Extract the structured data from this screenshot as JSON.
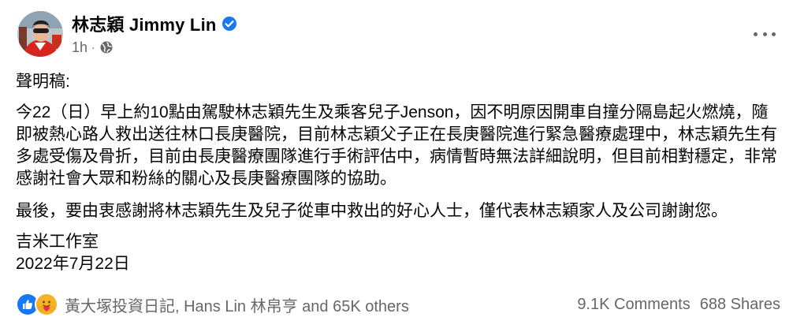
{
  "post": {
    "author": "林志穎 Jimmy Lin",
    "timestamp": "1h",
    "separator": "·",
    "body": {
      "greeting": "聲明稿:",
      "main": "今22（日）早上約10點由駕駛林志穎先生及乘客兒子Jenson，因不明原因開車自撞分隔島起火燃燒，隨即被熱心路人救出送往林口長庚醫院，目前林志穎父子正在長庚醫院進行緊急醫療處理中，林志穎先生有多處受傷及骨折，目前由長庚醫療團隊進行手術評估中，病情暫時無法詳細說明，但目前相對穩定，非常感謝社會大眾和粉絲的關心及長庚醫療團隊的協助。",
      "thanks": "最後，要由衷感謝將林志穎先生及兒子從車中救出的好心人士，僅代表林志穎家人及公司謝謝您。",
      "signature": "吉米工作室",
      "date": "2022年7月22日"
    },
    "reactions": {
      "icons": [
        "like-icon",
        "care-icon"
      ],
      "names": "黃大塚投資日記, Hans Lin 林帛亨 and 65K others"
    },
    "comments": "9.1K Comments",
    "shares": "688 Shares"
  },
  "colors": {
    "text": "#050505",
    "secondary_text": "#65676b",
    "verified": "#1877f2",
    "like": "#1877f2",
    "care": "#f7b125"
  }
}
